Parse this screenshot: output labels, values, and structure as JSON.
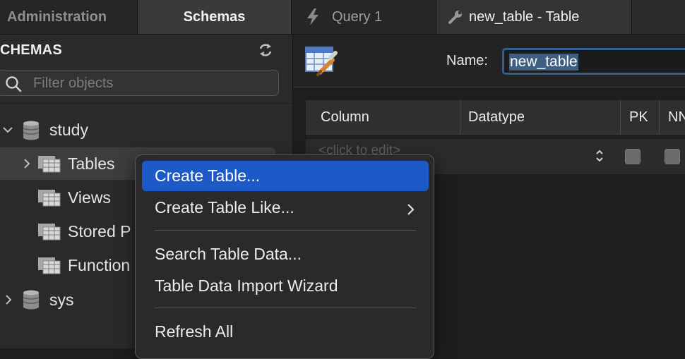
{
  "tabs": {
    "administration": "Administration",
    "schemas": "Schemas",
    "query": "Query 1",
    "new_table": "new_table - Table"
  },
  "sidebar": {
    "title": "CHEMAS",
    "filter_placeholder": "Filter objects",
    "tree": {
      "study": "study",
      "tables": "Tables",
      "views": "Views",
      "stored_procedures": "Stored P",
      "functions": "Function",
      "sys": "sys"
    }
  },
  "editor": {
    "name_label": "Name:",
    "name_value": "new_table",
    "columns": {
      "column": "Column",
      "datatype": "Datatype",
      "pk": "PK",
      "nn": "NN"
    },
    "placeholder_row": "<click to edit>"
  },
  "context_menu": {
    "create_table": "Create Table...",
    "create_table_like": "Create Table Like...",
    "search_table_data": "Search Table Data...",
    "import_wizard": "Table Data Import Wizard",
    "refresh_all": "Refresh All"
  },
  "colors": {
    "highlight": "#1d5ac8",
    "background": "#1e1e1e",
    "sidebar": "#2a2a2b"
  }
}
